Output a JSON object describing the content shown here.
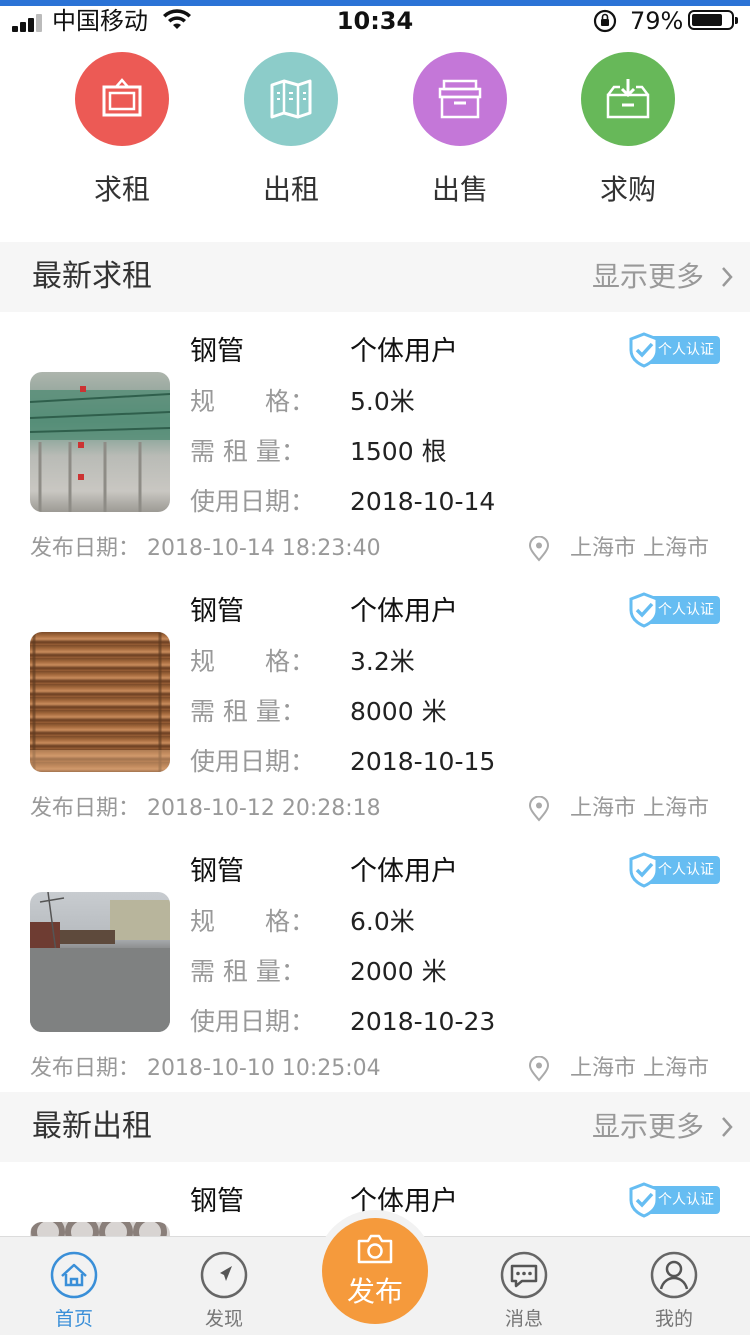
{
  "status_bar": {
    "carrier": "中国移动",
    "time": "10:34",
    "battery": "79%"
  },
  "categories": [
    {
      "label": "求租",
      "color": "#ec5a55",
      "icon": "frame-icon"
    },
    {
      "label": "出租",
      "color": "#8cccc9",
      "icon": "map-icon"
    },
    {
      "label": "出售",
      "color": "#c477d8",
      "icon": "box-icon"
    },
    {
      "label": "求购",
      "color": "#67b859",
      "icon": "download-box-icon"
    }
  ],
  "sections": [
    {
      "title": "最新求租",
      "more": "显示更多"
    },
    {
      "title": "最新出租",
      "more": "显示更多"
    }
  ],
  "labels": {
    "spec": "规　　格：",
    "quantity": "需 租 量：",
    "use_date": "使用日期：",
    "publish_date": "发布日期：",
    "badge": "个人认证"
  },
  "listings": [
    {
      "title": "钢管",
      "user_type": "个体用户",
      "spec": "5.0米",
      "quantity": "1500 根",
      "use_date": "2018-10-14",
      "publish_date": "2018-10-14 18:23:40",
      "location": "上海市 上海市"
    },
    {
      "title": "钢管",
      "user_type": "个体用户",
      "spec": "3.2米",
      "quantity": "8000 米",
      "use_date": "2018-10-15",
      "publish_date": "2018-10-12 20:28:18",
      "location": "上海市 上海市"
    },
    {
      "title": "钢管",
      "user_type": "个体用户",
      "spec": "6.0米",
      "quantity": "2000 米",
      "use_date": "2018-10-23",
      "publish_date": "2018-10-10 10:25:04",
      "location": "上海市 上海市"
    }
  ],
  "partial_listing": {
    "title": "钢管",
    "user_type": "个体用户"
  },
  "tabbar": {
    "home": "首页",
    "discover": "发现",
    "publish": "发布",
    "messages": "消息",
    "mine": "我的"
  },
  "colors": {
    "accent": "#3a8fd8",
    "publish": "#f59a3c",
    "badge": "#66bdf2"
  }
}
